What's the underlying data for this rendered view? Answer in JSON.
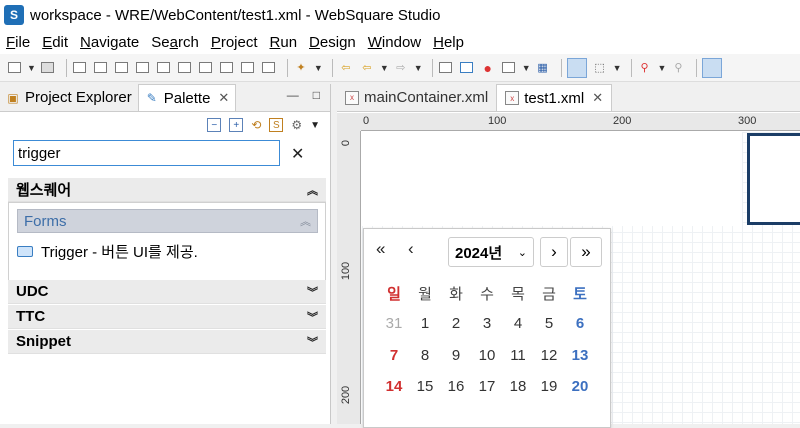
{
  "window": {
    "title": "workspace - WRE/WebContent/test1.xml - WebSquare Studio",
    "app_icon_text": "S"
  },
  "menu": [
    {
      "label": "File",
      "mn": "F",
      "rest": "ile"
    },
    {
      "label": "Edit",
      "mn": "E",
      "rest": "dit"
    },
    {
      "label": "Navigate",
      "mn": "N",
      "rest": "avigate"
    },
    {
      "label": "Search",
      "mn": "a",
      "pre": "Se",
      "rest": "rch"
    },
    {
      "label": "Project",
      "mn": "P",
      "rest": "roject"
    },
    {
      "label": "Run",
      "mn": "R",
      "rest": "un"
    },
    {
      "label": "Design",
      "mn": "D",
      "rest": "esign"
    },
    {
      "label": "Window",
      "mn": "W",
      "rest": "indow"
    },
    {
      "label": "Help",
      "mn": "H",
      "rest": "elp"
    }
  ],
  "left_tabs": {
    "project_explorer": "Project Explorer",
    "palette": "Palette"
  },
  "search": {
    "value": "trigger"
  },
  "categories": {
    "websquare": "웹스퀘어",
    "udc": "UDC",
    "ttc": "TTC",
    "snippet": "Snippet"
  },
  "drawer": {
    "label": "Forms"
  },
  "palette_item": {
    "label": "Trigger - 버튼 UI를 제공."
  },
  "editor_tabs": [
    {
      "label": "mainContainer.xml"
    },
    {
      "label": "test1.xml"
    }
  ],
  "ruler": {
    "h_labels": [
      "0",
      "100",
      "200",
      "300"
    ],
    "v_labels": [
      "0",
      "100",
      "200"
    ]
  },
  "calendar": {
    "year": "2024년",
    "weekdays": [
      "일",
      "월",
      "화",
      "수",
      "목",
      "금",
      "토"
    ],
    "weeks": [
      [
        "31",
        "1",
        "2",
        "3",
        "4",
        "5",
        "6"
      ],
      [
        "7",
        "8",
        "9",
        "10",
        "11",
        "12",
        "13"
      ],
      [
        "14",
        "15",
        "16",
        "17",
        "18",
        "19",
        "20"
      ]
    ]
  },
  "colors": {
    "accent": "#3c8bd6",
    "sunday": "#d13030",
    "saturday": "#3c70c0",
    "selected_box": "#1b3d66"
  }
}
